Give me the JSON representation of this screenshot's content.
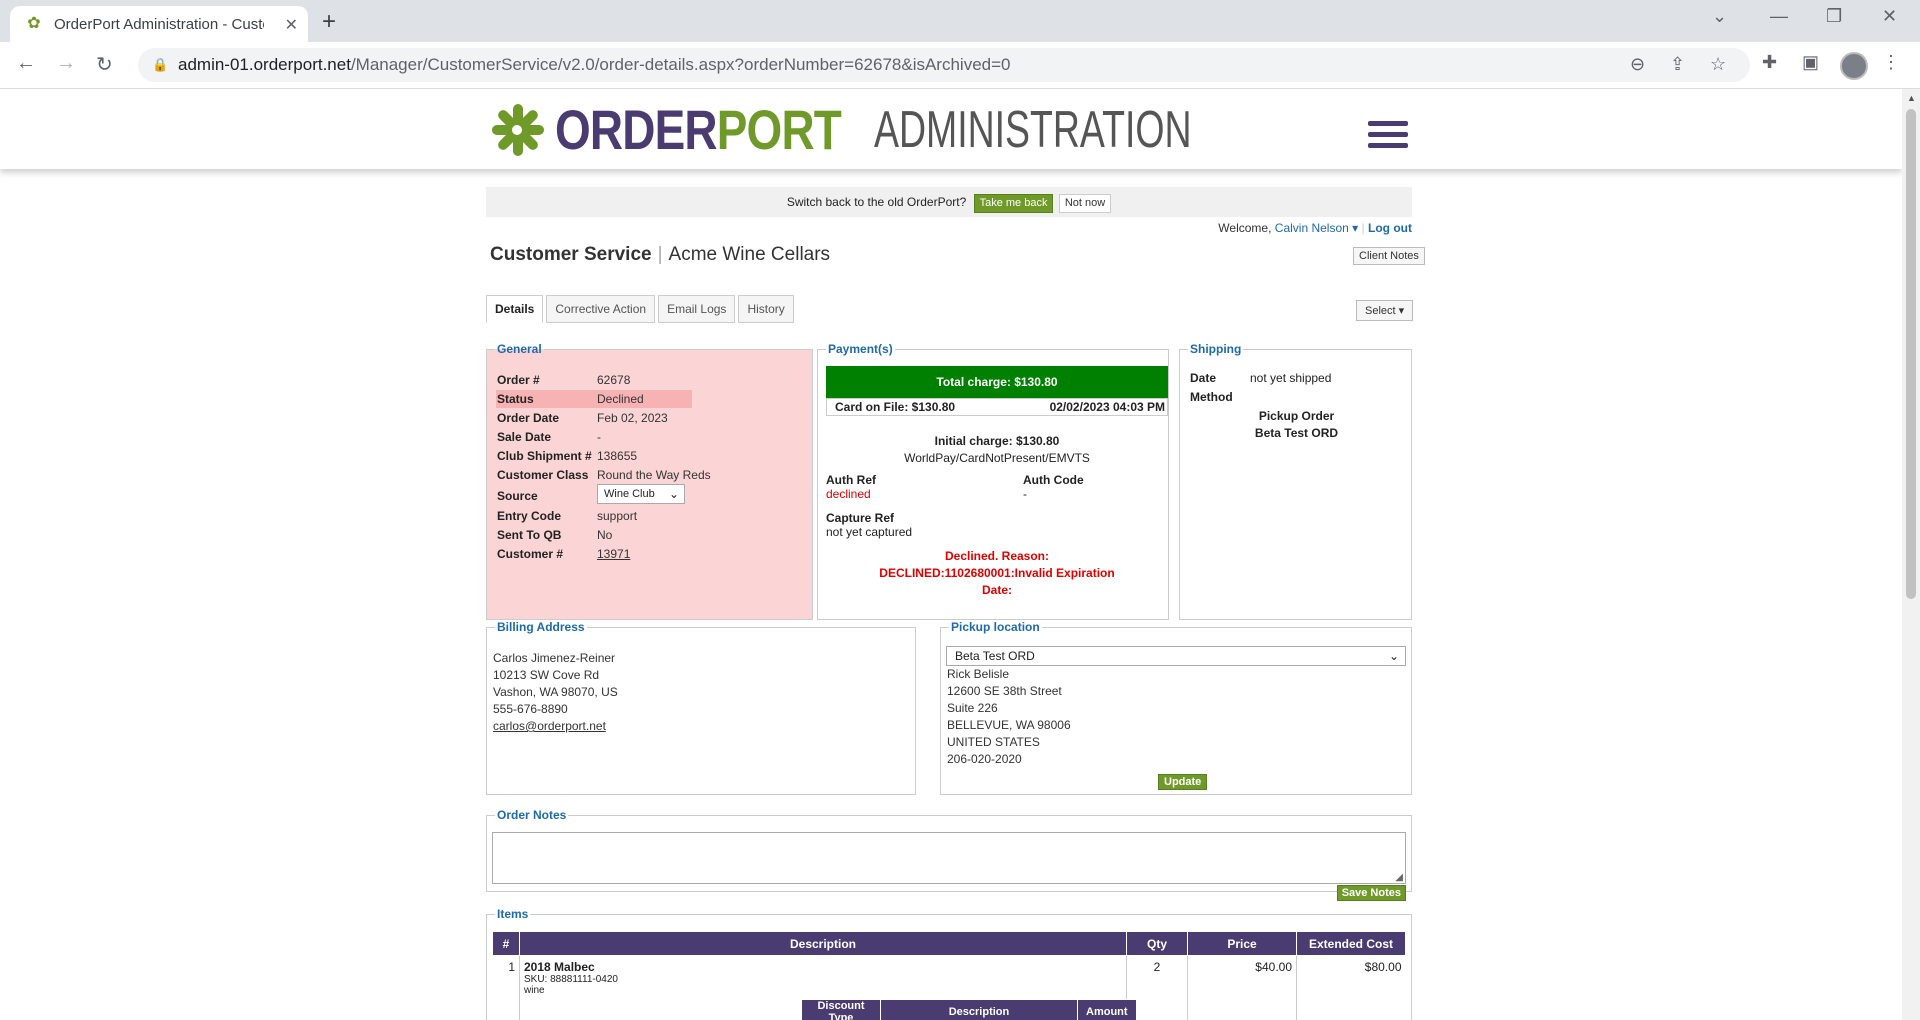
{
  "browser": {
    "tab_title": "OrderPort Administration - Custo",
    "url_host": "admin-01.orderport.net",
    "url_path": "/Manager/CustomerService/v2.0/order-details.aspx?orderNumber=62678&isArchived=0"
  },
  "header": {
    "logo_order": "ORDER",
    "logo_port": "PORT",
    "logo_admin": "ADMINISTRATION"
  },
  "switchbar": {
    "text": "Switch back to the old OrderPort?",
    "take_me_back": "Take me back",
    "not_now": "Not now"
  },
  "welcome": {
    "label": "Welcome,",
    "user": "Calvin Nelson",
    "logout": "Log out",
    "client_notes": "Client Notes"
  },
  "title": {
    "section": "Customer Service",
    "client": "Acme Wine Cellars"
  },
  "tabs": [
    "Details",
    "Corrective Action",
    "Email Logs",
    "History"
  ],
  "select_label": "Select",
  "general": {
    "legend": "General",
    "rows": [
      {
        "label": "Order #",
        "value": "62678"
      },
      {
        "label": "Status",
        "value": "Declined"
      },
      {
        "label": "Order Date",
        "value": "Feb 02, 2023"
      },
      {
        "label": "Sale Date",
        "value": "-"
      },
      {
        "label": "Club Shipment #",
        "value": "138655"
      },
      {
        "label": "Customer Class",
        "value": "Round the Way Reds"
      },
      {
        "label": "Source",
        "value": "Wine Club"
      },
      {
        "label": "Entry Code",
        "value": "support"
      },
      {
        "label": "Sent To QB",
        "value": "No"
      },
      {
        "label": "Customer #",
        "value": "13971"
      }
    ]
  },
  "payment": {
    "legend": "Payment(s)",
    "total_charge": "Total charge: $130.80",
    "card_on_file": "Card on File: $130.80",
    "card_datetime": "02/02/2023 04:03 PM",
    "initial_charge": "Initial charge: $130.80",
    "processor": "WorldPay/CardNotPresent/EMVTS",
    "auth_ref_label": "Auth Ref",
    "auth_ref_value": "declined",
    "auth_code_label": "Auth Code",
    "auth_code_value": "-",
    "capture_ref_label": "Capture Ref",
    "capture_ref_value": "not yet captured",
    "decline_line1": "Declined. Reason:",
    "decline_line2": "DECLINED:1102680001:Invalid Expiration",
    "decline_line3": "Date:"
  },
  "shipping": {
    "legend": "Shipping",
    "date_label": "Date",
    "date_value": "not yet shipped",
    "method_label": "Method",
    "method_line1": "Pickup Order",
    "method_line2": "Beta Test ORD"
  },
  "billing": {
    "legend": "Billing Address",
    "name": "Carlos Jimenez-Reiner",
    "street": "10213 SW Cove Rd",
    "city": "Vashon, WA 98070, US",
    "phone": "555-676-8890",
    "email": "carlos@orderport.net"
  },
  "pickup": {
    "legend": "Pickup location",
    "selected": "Beta Test ORD",
    "contact": "Rick Belisle",
    "street": "12600 SE 38th Street",
    "suite": "Suite 226",
    "city": "BELLEVUE, WA 98006",
    "country": "UNITED STATES",
    "phone": "206-020-2020",
    "update": "Update"
  },
  "notes": {
    "legend": "Order Notes",
    "save": "Save Notes"
  },
  "items": {
    "legend": "Items",
    "columns": [
      "#",
      "Description",
      "Qty",
      "Price",
      "Extended Cost"
    ],
    "rows": [
      {
        "num": "1",
        "name": "2018 Malbec",
        "sku": "SKU: 88881111-0420",
        "type": "wine",
        "qty": "2",
        "price": "$40.00",
        "extended": "$80.00"
      }
    ],
    "discount_columns": [
      "Discount Type",
      "Description",
      "Amount"
    ]
  }
}
